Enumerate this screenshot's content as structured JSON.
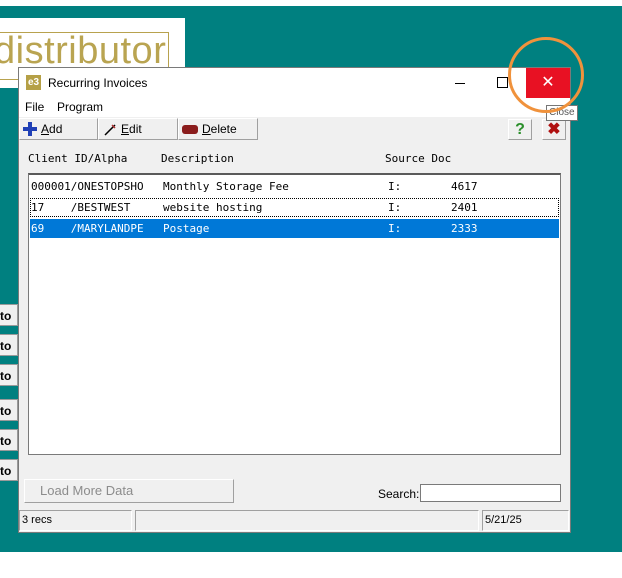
{
  "logo": {
    "text": "distributor"
  },
  "side_buttons": [
    "to",
    "to",
    "to",
    "to",
    "to",
    "to"
  ],
  "window": {
    "title": "Recurring Invoices",
    "app_icon": "e3",
    "close_glyph": "✕"
  },
  "menu": [
    "File",
    "Program"
  ],
  "toolbar": {
    "add_label": "Add",
    "edit_label": "Edit",
    "delete_label": "Delete",
    "help_glyph": "?",
    "exit_glyph": "✖"
  },
  "list": {
    "headers": {
      "client": "Client ID/Alpha",
      "description": "Description",
      "source": "Source Doc"
    },
    "rows": [
      {
        "client": "000001/ONESTOPSHO",
        "description": "Monthly Storage Fee",
        "type": "I:",
        "doc": "4617"
      },
      {
        "client": "17    /BESTWEST",
        "description": "website hosting",
        "type": "I:",
        "doc": "2401"
      },
      {
        "client": "69    /MARYLANDPE",
        "description": "Postage",
        "type": "I:",
        "doc": "2333"
      }
    ]
  },
  "load_more_label": "Load More Data",
  "search": {
    "label": "Search:",
    "value": ""
  },
  "status": {
    "records": "3 recs",
    "middle": "",
    "date": "5/21/25"
  },
  "tooltip": "Close",
  "colors": {
    "desktop": "#008080",
    "close": "#e81123",
    "selection": "#0078d7",
    "ring": "#f0923c"
  }
}
